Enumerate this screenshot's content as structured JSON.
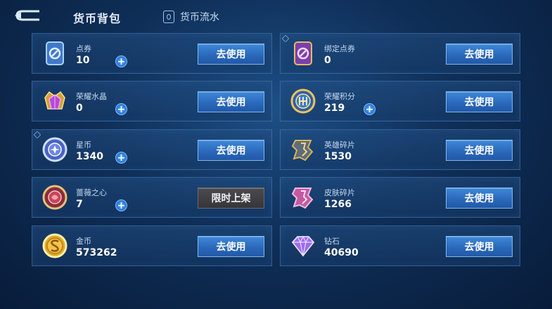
{
  "header": {
    "title": "货币背包",
    "flow_label": "货币流水"
  },
  "items": [
    {
      "name": "点券",
      "amount": "10",
      "button": "去使用",
      "icon": "coupon-icon"
    },
    {
      "name": "绑定点券",
      "amount": "0",
      "button": "去使用",
      "icon": "bound-coupon-icon"
    },
    {
      "name": "荣耀水晶",
      "amount": "0",
      "button": "去使用",
      "icon": "honor-crystal-icon"
    },
    {
      "name": "荣耀积分",
      "amount": "219",
      "button": "去使用",
      "icon": "honor-points-icon"
    },
    {
      "name": "星币",
      "amount": "1340",
      "button": "去使用",
      "icon": "star-coin-icon"
    },
    {
      "name": "英雄碎片",
      "amount": "1530",
      "button": "去使用",
      "icon": "hero-fragment-icon"
    },
    {
      "name": "蔷薇之心",
      "amount": "7",
      "button": "限时上架",
      "icon": "rose-heart-icon"
    },
    {
      "name": "皮肤碎片",
      "amount": "1266",
      "button": "去使用",
      "icon": "skin-fragment-icon"
    },
    {
      "name": "金币",
      "amount": "573262",
      "button": "去使用",
      "icon": "gold-coin-icon"
    },
    {
      "name": "钻石",
      "amount": "40690",
      "button": "去使用",
      "icon": "diamond-icon"
    }
  ],
  "plus_symbol": "+"
}
